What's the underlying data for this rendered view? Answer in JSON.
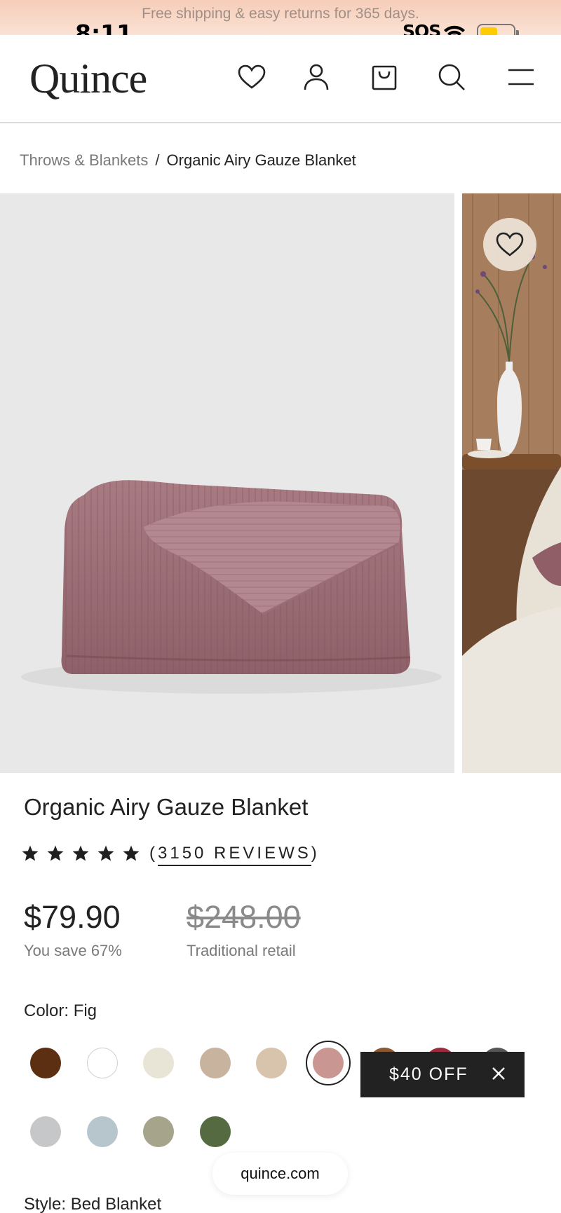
{
  "promo": {
    "text": "Free shipping & easy returns for 365 days."
  },
  "status_bar": {
    "time": "8:11",
    "sos": "SOS"
  },
  "header": {
    "logo": "Quince",
    "icons": [
      "heart-icon",
      "account-icon",
      "bag-icon",
      "search-icon",
      "menu-icon"
    ]
  },
  "breadcrumb": {
    "parent": "Throws & Blankets",
    "separator": "/",
    "current": "Organic Airy Gauze Blanket"
  },
  "product": {
    "title": "Organic Airy Gauze Blanket",
    "rating_stars": 5,
    "reviews_open": "(",
    "reviews_text": "3150 REVIEWS",
    "reviews_close": ")",
    "price": "$79.90",
    "savings": "You save 67%",
    "retail_price": "$248.00",
    "retail_label": "Traditional retail"
  },
  "color": {
    "label": "Color: Fig",
    "swatches": [
      "#5c2f12",
      "#ffffff",
      "#e8e5d6",
      "#c7b39e",
      "#d8c3ac",
      "#c99691",
      "#8a5733",
      "#9c2b3b",
      "#555555",
      "#c6c7c8",
      "#b6c6cc",
      "#a6a58c",
      "#566a42"
    ],
    "selected_index": 5
  },
  "offer": {
    "text": "$40 OFF",
    "close": "×"
  },
  "browser": {
    "url": "quince.com"
  },
  "style": {
    "label": "Style: Bed Blanket"
  }
}
